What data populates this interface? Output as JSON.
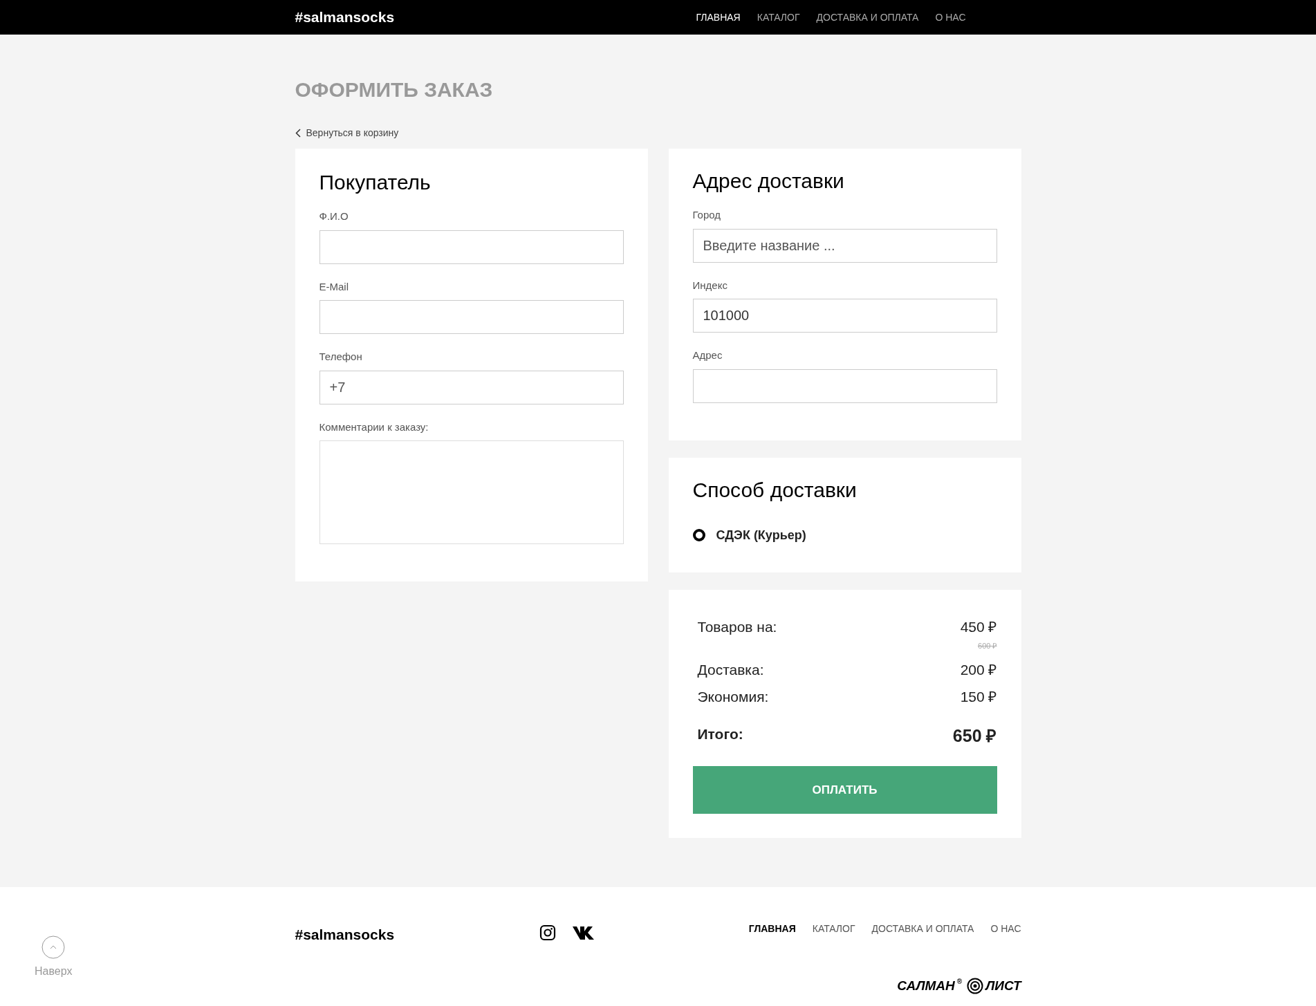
{
  "header": {
    "logo": "#salmansocks",
    "nav": [
      {
        "label": "ГЛАВНАЯ",
        "selected": true
      },
      {
        "label": "КАТАЛОГ",
        "selected": false
      },
      {
        "label": "ДОСТАВКА И ОПЛАТА",
        "selected": false
      },
      {
        "label": "О НАС",
        "selected": false
      }
    ]
  },
  "page_title": "ОФОРМИТЬ ЗАКАЗ",
  "back_link": "Вернуться в корзину",
  "buyer": {
    "title": "Покупатель",
    "fields": [
      {
        "label": "Ф.И.О",
        "kind": "input"
      },
      {
        "label": "E-Mail",
        "kind": "input"
      },
      {
        "label": "Телефон",
        "kind": "input",
        "placeholder": "+7"
      },
      {
        "label": "Комментарии к заказу:",
        "kind": "textarea"
      }
    ]
  },
  "address": {
    "title": "Адрес доставки",
    "fields": [
      {
        "label": "Город",
        "kind": "input",
        "placeholder": "Введите название ..."
      },
      {
        "label": "Индекс",
        "kind": "input",
        "value": "101000"
      },
      {
        "label": "Адрес",
        "kind": "input"
      }
    ]
  },
  "delivery": {
    "title": "Способ доставки",
    "options": [
      {
        "label": "СДЭК (Курьер)",
        "selected": true
      }
    ]
  },
  "summary": {
    "lines": [
      {
        "label": "Товаров на:",
        "value": "450 ₽",
        "old_value": "600 ₽"
      },
      {
        "label": "Доставка:",
        "value": "200 ₽"
      },
      {
        "label": "Экономия:",
        "value": "150 ₽"
      }
    ],
    "total_label": "Итого:",
    "total_value": "650 ₽",
    "pay_button": "ОПЛАТИТЬ"
  },
  "footer": {
    "to_top": "Наверх",
    "logo": "#salmansocks",
    "nav": [
      {
        "label": "ГЛАВНАЯ",
        "selected": true
      },
      {
        "label": "КАТАЛОГ",
        "selected": false
      },
      {
        "label": "ДОСТАВКА И ОПЛАТА",
        "selected": false
      },
      {
        "label": "О НАС",
        "selected": false
      }
    ],
    "brand": {
      "name": "САЛМАН",
      "mark": "®",
      "name2": "ЛИСТ"
    }
  }
}
